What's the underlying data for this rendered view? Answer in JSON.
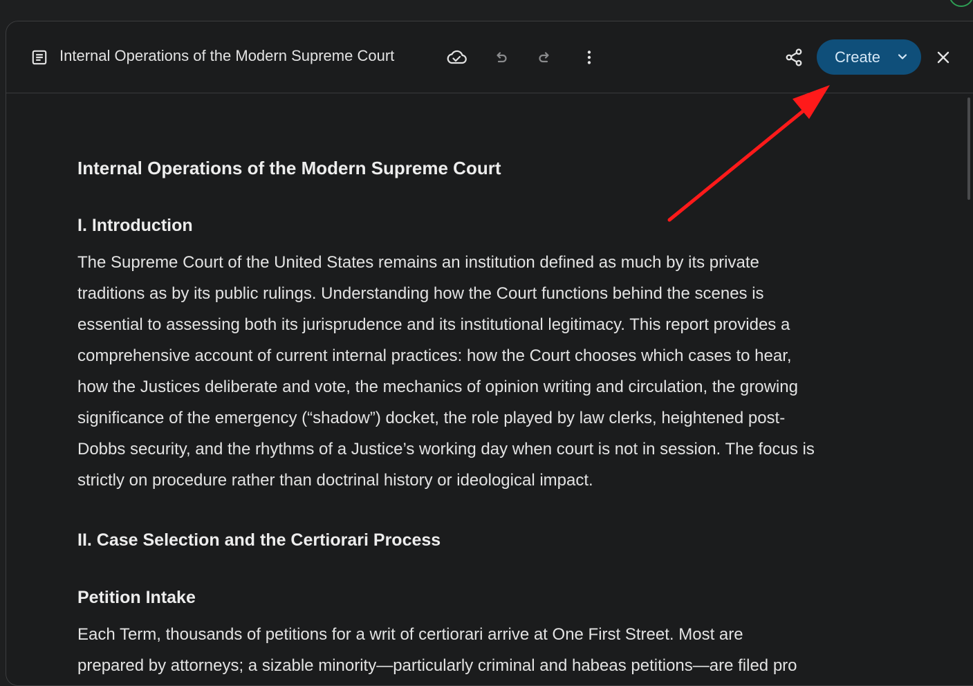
{
  "toolbar": {
    "doc_title": "Internal Operations of the Modern Supreme Court",
    "create_label": "Create",
    "icons": {
      "doc": "document-icon",
      "cloud": "cloud-saved-icon",
      "undo": "undo-icon",
      "redo": "redo-icon",
      "more": "more-vert-icon",
      "share": "share-icon",
      "chevron": "chevron-down-icon",
      "close": "close-icon"
    },
    "accent_color": "#0f4f7a"
  },
  "document": {
    "title": "Internal Operations of the Modern Supreme Court",
    "sections": [
      {
        "heading": "I. Introduction",
        "lines": [
          "The Supreme Court of the United States remains an institution defined as much by its private",
          "traditions as by its public rulings. Understanding how the Court functions behind the scenes is",
          "essential to assessing both its jurisprudence and its institutional legitimacy. This report provides a",
          "comprehensive account of current internal practices: how the Court chooses which cases to hear,",
          "how the Justices deliberate and vote, the mechanics of opinion writing and circulation, the growing",
          "significance of the emergency (“shadow”) docket, the role played by law clerks, heightened post-",
          "Dobbs security, and the rhythms of a Justice’s working day when court is not in session. The focus is",
          "strictly on procedure rather than doctrinal history or ideological impact."
        ]
      },
      {
        "heading": "II. Case Selection and the Certiorari Process"
      },
      {
        "heading": "Petition Intake",
        "lines": [
          "Each Term, thousands of petitions for a writ of certiorari arrive at One First Street. Most are",
          "prepared by attorneys; a sizable minority—particularly criminal and habeas petitions—are filed pro"
        ]
      }
    ]
  },
  "annotation": {
    "type": "arrow",
    "color": "#ff1a1a",
    "target": "create-button"
  }
}
